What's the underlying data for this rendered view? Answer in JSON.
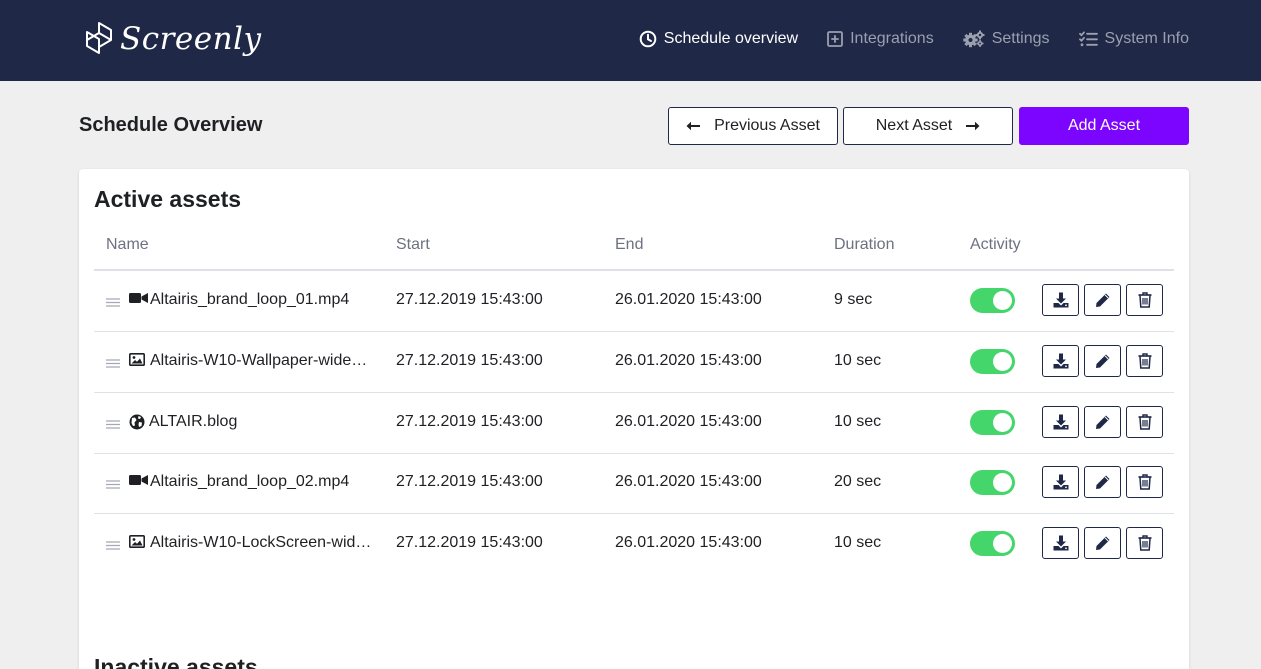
{
  "brand": {
    "name": "Screenly"
  },
  "nav": [
    {
      "label": "Schedule overview",
      "icon": "clock-icon",
      "active": true
    },
    {
      "label": "Integrations",
      "icon": "plus-square-icon",
      "active": false
    },
    {
      "label": "Settings",
      "icon": "gears-icon",
      "active": false
    },
    {
      "label": "System Info",
      "icon": "checklist-icon",
      "active": false
    }
  ],
  "page": {
    "title": "Schedule Overview"
  },
  "toolbar": {
    "prev_label": "Previous Asset",
    "next_label": "Next Asset",
    "add_label": "Add Asset"
  },
  "active_assets": {
    "title": "Active assets",
    "columns": {
      "name": "Name",
      "start": "Start",
      "end": "End",
      "duration": "Duration",
      "activity": "Activity"
    },
    "rows": [
      {
        "type": "video-icon",
        "name": "Altairis_brand_loop_01.mp4",
        "start": "27.12.2019 15:43:00",
        "end": "26.01.2020 15:43:00",
        "duration": "9 sec",
        "active": true
      },
      {
        "type": "image-icon",
        "name": "Altairis-W10-Wallpaper-wide…",
        "start": "27.12.2019 15:43:00",
        "end": "26.01.2020 15:43:00",
        "duration": "10 sec",
        "active": true
      },
      {
        "type": "globe-icon",
        "name": "ALTAIR.blog",
        "start": "27.12.2019 15:43:00",
        "end": "26.01.2020 15:43:00",
        "duration": "10 sec",
        "active": true
      },
      {
        "type": "video-icon",
        "name": "Altairis_brand_loop_02.mp4",
        "start": "27.12.2019 15:43:00",
        "end": "26.01.2020 15:43:00",
        "duration": "20 sec",
        "active": true
      },
      {
        "type": "image-icon",
        "name": "Altairis-W10-LockScreen-wid…",
        "start": "27.12.2019 15:43:00",
        "end": "26.01.2020 15:43:00",
        "duration": "10 sec",
        "active": true
      }
    ]
  },
  "inactive_assets": {
    "title": "Inactive assets"
  },
  "colors": {
    "navbar": "#1f2846",
    "accent": "#7b05ff",
    "toggle_on": "#44d66b"
  }
}
